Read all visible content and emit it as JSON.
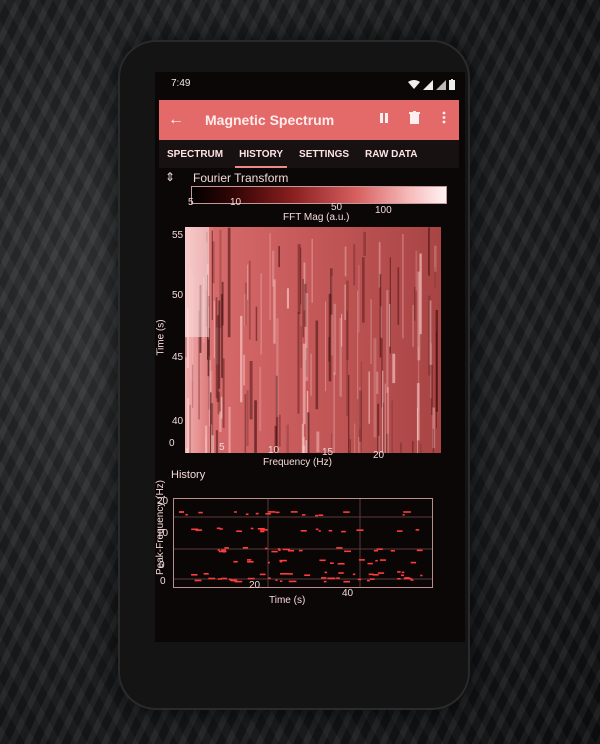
{
  "status": {
    "time": "7:49"
  },
  "appbar": {
    "title": "Magnetic Spectrum",
    "back_icon": "arrow-left-icon",
    "pause_icon": "pause-icon",
    "delete_icon": "trash-icon",
    "more_icon": "more-vert-icon"
  },
  "tabs": [
    "SPECTRUM",
    "HISTORY",
    "SETTINGS",
    "RAW DATA"
  ],
  "active_tab": "HISTORY",
  "fourier": {
    "title": "Fourier Transform",
    "colorbar_ticks": [
      "5",
      "10",
      "50",
      "100"
    ],
    "colorbar_label": "FFT Mag (a.u.)",
    "ylabel": "Time (s)",
    "yticks": [
      "55",
      "50",
      "45",
      "40"
    ],
    "xlabel": "Frequency (Hz)",
    "xticks": [
      "0",
      "5",
      "10",
      "15",
      "20"
    ]
  },
  "history": {
    "title": "History",
    "ylabel": "Peak-Frequency (Hz)",
    "yticks": [
      "20",
      "10",
      "0"
    ],
    "xlabel": "Time (s)",
    "xticks": [
      "0",
      "20",
      "40"
    ]
  },
  "colors": {
    "accent": "#e46a6a",
    "tab_bg": "#181111",
    "plot_point": "#ff3b3b"
  }
}
